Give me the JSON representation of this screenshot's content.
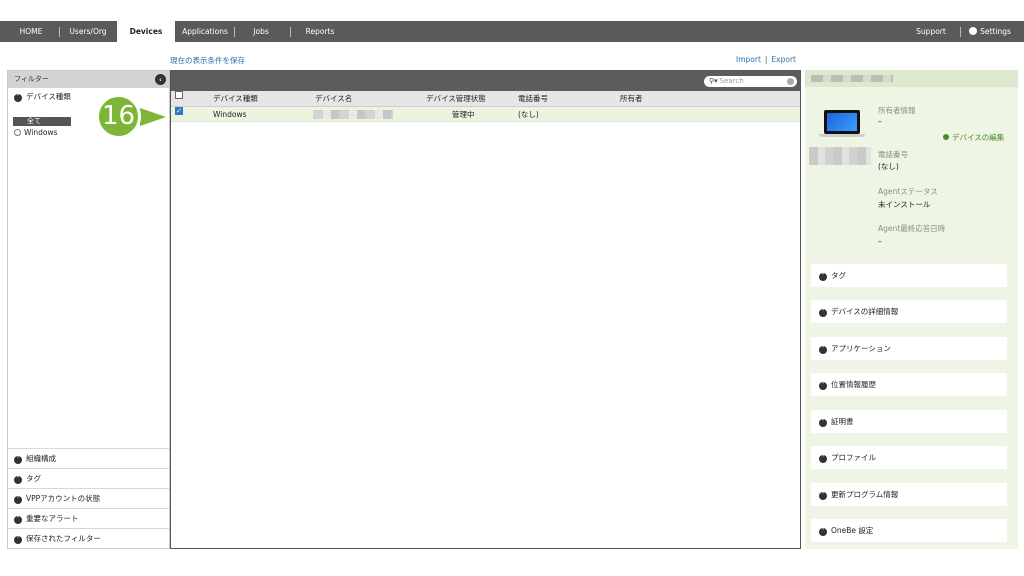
{
  "nav": {
    "tabs": [
      "HOME",
      "Users/Org",
      "Devices",
      "Applications",
      "Jobs",
      "Reports"
    ],
    "support": "Support",
    "settings": "Settings"
  },
  "toolbar": {
    "save_condition": "現在の表示条件を保存",
    "import": "Import",
    "separator": "|",
    "export": "Export"
  },
  "sidebar": {
    "title": "フィルター",
    "device_type": "デバイス種類",
    "type_all": "全て",
    "type_windows": "Windows",
    "bottom_items": [
      "組織構成",
      "タグ",
      "VPPアカウントの状態",
      "重要なアラート",
      "保存されたフィルター"
    ]
  },
  "step_badge": "16",
  "table": {
    "search_placeholder": "Search",
    "columns": [
      "デバイス種類",
      "デバイス名",
      "デバイス管理状態",
      "電話番号",
      "所有者"
    ],
    "rows": [
      {
        "checked": true,
        "type": "Windows",
        "name": "",
        "status": "管理中",
        "phone": "(なし)",
        "owner": ""
      }
    ]
  },
  "detail": {
    "owner_label": "所有者情報",
    "owner_value": "–",
    "edit_link": "デバイスの編集",
    "phone_label": "電話番号",
    "phone_value": "(なし)",
    "agent_status_label": "Agentステータス",
    "agent_status_value": "未インストール",
    "agent_last_label": "Agent最終応答日時",
    "agent_last_value": "–",
    "sections": [
      "タグ",
      "デバイスの詳細情報",
      "アプリケーション",
      "位置情報履歴",
      "証明書",
      "プロファイル",
      "更新プログラム情報",
      "OneBe 設定"
    ]
  }
}
